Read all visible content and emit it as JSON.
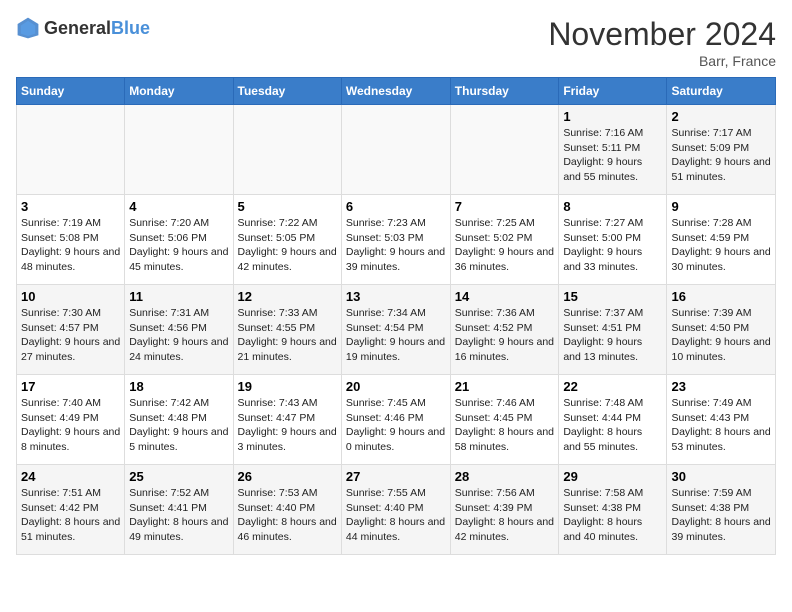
{
  "logo": {
    "general": "General",
    "blue": "Blue"
  },
  "title": "November 2024",
  "location": "Barr, France",
  "days_of_week": [
    "Sunday",
    "Monday",
    "Tuesday",
    "Wednesday",
    "Thursday",
    "Friday",
    "Saturday"
  ],
  "weeks": [
    [
      {
        "day": "",
        "detail": ""
      },
      {
        "day": "",
        "detail": ""
      },
      {
        "day": "",
        "detail": ""
      },
      {
        "day": "",
        "detail": ""
      },
      {
        "day": "",
        "detail": ""
      },
      {
        "day": "1",
        "detail": "Sunrise: 7:16 AM\nSunset: 5:11 PM\nDaylight: 9 hours and 55 minutes."
      },
      {
        "day": "2",
        "detail": "Sunrise: 7:17 AM\nSunset: 5:09 PM\nDaylight: 9 hours and 51 minutes."
      }
    ],
    [
      {
        "day": "3",
        "detail": "Sunrise: 7:19 AM\nSunset: 5:08 PM\nDaylight: 9 hours and 48 minutes."
      },
      {
        "day": "4",
        "detail": "Sunrise: 7:20 AM\nSunset: 5:06 PM\nDaylight: 9 hours and 45 minutes."
      },
      {
        "day": "5",
        "detail": "Sunrise: 7:22 AM\nSunset: 5:05 PM\nDaylight: 9 hours and 42 minutes."
      },
      {
        "day": "6",
        "detail": "Sunrise: 7:23 AM\nSunset: 5:03 PM\nDaylight: 9 hours and 39 minutes."
      },
      {
        "day": "7",
        "detail": "Sunrise: 7:25 AM\nSunset: 5:02 PM\nDaylight: 9 hours and 36 minutes."
      },
      {
        "day": "8",
        "detail": "Sunrise: 7:27 AM\nSunset: 5:00 PM\nDaylight: 9 hours and 33 minutes."
      },
      {
        "day": "9",
        "detail": "Sunrise: 7:28 AM\nSunset: 4:59 PM\nDaylight: 9 hours and 30 minutes."
      }
    ],
    [
      {
        "day": "10",
        "detail": "Sunrise: 7:30 AM\nSunset: 4:57 PM\nDaylight: 9 hours and 27 minutes."
      },
      {
        "day": "11",
        "detail": "Sunrise: 7:31 AM\nSunset: 4:56 PM\nDaylight: 9 hours and 24 minutes."
      },
      {
        "day": "12",
        "detail": "Sunrise: 7:33 AM\nSunset: 4:55 PM\nDaylight: 9 hours and 21 minutes."
      },
      {
        "day": "13",
        "detail": "Sunrise: 7:34 AM\nSunset: 4:54 PM\nDaylight: 9 hours and 19 minutes."
      },
      {
        "day": "14",
        "detail": "Sunrise: 7:36 AM\nSunset: 4:52 PM\nDaylight: 9 hours and 16 minutes."
      },
      {
        "day": "15",
        "detail": "Sunrise: 7:37 AM\nSunset: 4:51 PM\nDaylight: 9 hours and 13 minutes."
      },
      {
        "day": "16",
        "detail": "Sunrise: 7:39 AM\nSunset: 4:50 PM\nDaylight: 9 hours and 10 minutes."
      }
    ],
    [
      {
        "day": "17",
        "detail": "Sunrise: 7:40 AM\nSunset: 4:49 PM\nDaylight: 9 hours and 8 minutes."
      },
      {
        "day": "18",
        "detail": "Sunrise: 7:42 AM\nSunset: 4:48 PM\nDaylight: 9 hours and 5 minutes."
      },
      {
        "day": "19",
        "detail": "Sunrise: 7:43 AM\nSunset: 4:47 PM\nDaylight: 9 hours and 3 minutes."
      },
      {
        "day": "20",
        "detail": "Sunrise: 7:45 AM\nSunset: 4:46 PM\nDaylight: 9 hours and 0 minutes."
      },
      {
        "day": "21",
        "detail": "Sunrise: 7:46 AM\nSunset: 4:45 PM\nDaylight: 8 hours and 58 minutes."
      },
      {
        "day": "22",
        "detail": "Sunrise: 7:48 AM\nSunset: 4:44 PM\nDaylight: 8 hours and 55 minutes."
      },
      {
        "day": "23",
        "detail": "Sunrise: 7:49 AM\nSunset: 4:43 PM\nDaylight: 8 hours and 53 minutes."
      }
    ],
    [
      {
        "day": "24",
        "detail": "Sunrise: 7:51 AM\nSunset: 4:42 PM\nDaylight: 8 hours and 51 minutes."
      },
      {
        "day": "25",
        "detail": "Sunrise: 7:52 AM\nSunset: 4:41 PM\nDaylight: 8 hours and 49 minutes."
      },
      {
        "day": "26",
        "detail": "Sunrise: 7:53 AM\nSunset: 4:40 PM\nDaylight: 8 hours and 46 minutes."
      },
      {
        "day": "27",
        "detail": "Sunrise: 7:55 AM\nSunset: 4:40 PM\nDaylight: 8 hours and 44 minutes."
      },
      {
        "day": "28",
        "detail": "Sunrise: 7:56 AM\nSunset: 4:39 PM\nDaylight: 8 hours and 42 minutes."
      },
      {
        "day": "29",
        "detail": "Sunrise: 7:58 AM\nSunset: 4:38 PM\nDaylight: 8 hours and 40 minutes."
      },
      {
        "day": "30",
        "detail": "Sunrise: 7:59 AM\nSunset: 4:38 PM\nDaylight: 8 hours and 39 minutes."
      }
    ]
  ]
}
